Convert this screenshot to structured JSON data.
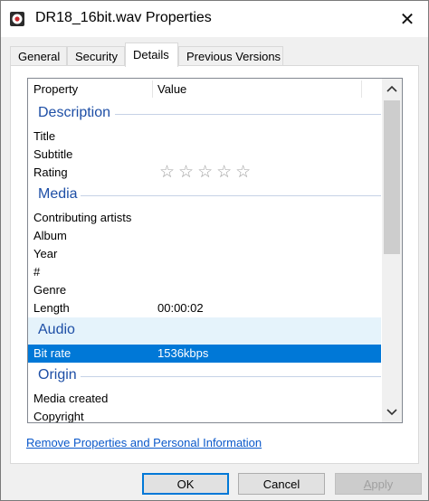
{
  "window": {
    "title": "DR18_16bit.wav Properties",
    "close_label": "✕",
    "app_icon": "media-file-icon"
  },
  "tabs": [
    {
      "label": "General"
    },
    {
      "label": "Security"
    },
    {
      "label": "Details"
    },
    {
      "label": "Previous Versions"
    }
  ],
  "active_tab": "Details",
  "list": {
    "header_property": "Property",
    "header_value": "Value",
    "groups": {
      "description": "Description",
      "media": "Media",
      "audio": "Audio",
      "origin": "Origin"
    },
    "rows": {
      "title": {
        "name": "Title",
        "value": ""
      },
      "subtitle": {
        "name": "Subtitle",
        "value": ""
      },
      "rating": {
        "name": "Rating",
        "value": "☆☆☆☆☆"
      },
      "contributing_artists": {
        "name": "Contributing artists",
        "value": ""
      },
      "album": {
        "name": "Album",
        "value": ""
      },
      "year": {
        "name": "Year",
        "value": ""
      },
      "number": {
        "name": "#",
        "value": ""
      },
      "genre": {
        "name": "Genre",
        "value": ""
      },
      "length": {
        "name": "Length",
        "value": "00:00:02"
      },
      "bit_rate": {
        "name": "Bit rate",
        "value": "1536kbps"
      },
      "media_created": {
        "name": "Media created",
        "value": ""
      },
      "copyright": {
        "name": "Copyright",
        "value": ""
      }
    },
    "selected_row": "Bit rate",
    "scroll_up_glyph": "︿",
    "scroll_down_glyph": "﹀"
  },
  "link_text": "Remove Properties and Personal Information",
  "buttons": {
    "ok": "OK",
    "cancel": "Cancel",
    "apply_prefix": "",
    "apply_underlined": "A",
    "apply_rest": "pply"
  },
  "colors": {
    "accent": "#0078d7",
    "group_header": "#1e4fa6",
    "link": "#0a58ca"
  }
}
